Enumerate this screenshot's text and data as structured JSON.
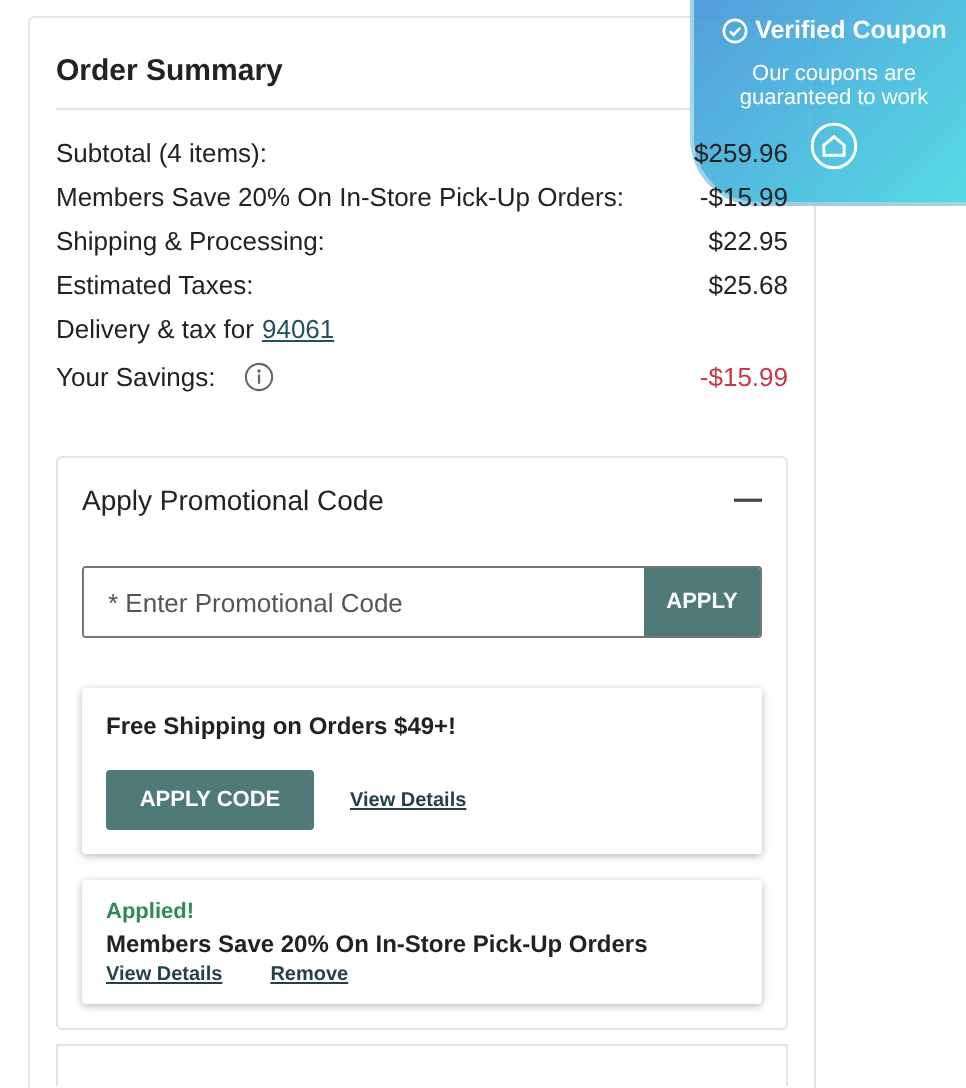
{
  "order_summary": {
    "title": "Order Summary",
    "rows": [
      {
        "kind": "line",
        "label": "Subtotal (4 items):",
        "value": "$259.96"
      },
      {
        "kind": "line",
        "label": "Members Save 20% On In-Store Pick-Up Orders:",
        "value": "-$15.99"
      },
      {
        "kind": "line",
        "label": "Shipping & Processing:",
        "value": "$22.95"
      },
      {
        "kind": "line",
        "label": "Estimated Taxes:",
        "value": "$25.68"
      },
      {
        "kind": "zip",
        "label": "Delivery & tax for",
        "link": "94061"
      },
      {
        "kind": "savings",
        "label": "Your Savings:",
        "value": "-$15.99"
      }
    ]
  },
  "promo": {
    "title": "Apply Promotional Code",
    "expanded": true,
    "placeholder": "* Enter Promotional Code",
    "button": "APPLY",
    "offers": [
      {
        "kind": "available",
        "title": "Free Shipping on Orders $49+!",
        "button": "APPLY CODE",
        "link": "View Details"
      },
      {
        "kind": "applied",
        "status": "Applied!",
        "title": "Members Save 20% On In-Store Pick-Up Orders",
        "link": "View Details",
        "remove": "Remove"
      }
    ]
  },
  "verified_badge": {
    "title": "Verified Coupon",
    "text": "Our coupons are guaranteed to work"
  }
}
